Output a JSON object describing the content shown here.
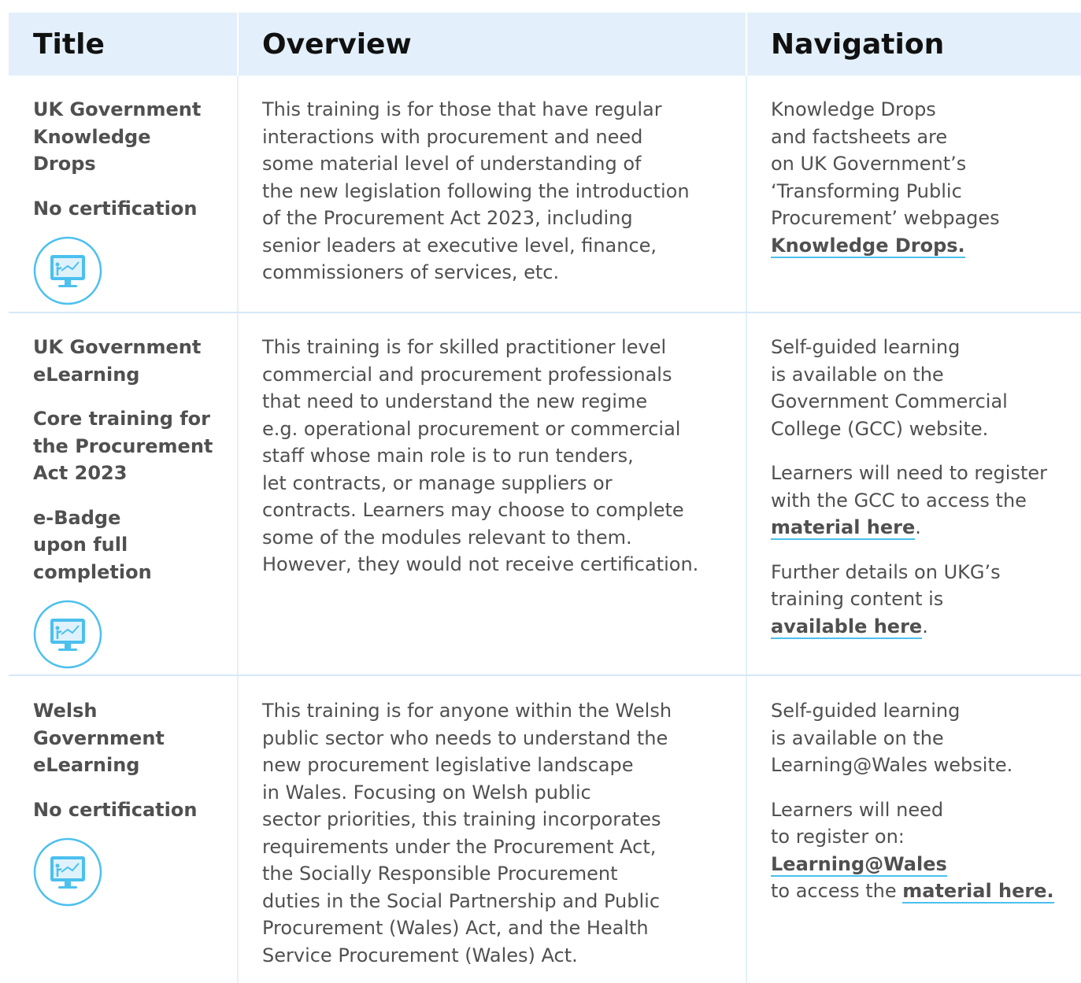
{
  "header": {
    "title": "Title",
    "overview": "Overview",
    "navigation": "Navigation"
  },
  "colors": {
    "header_bg": "#e3f0fb",
    "link_underline": "#4cc0ee",
    "icon_blue": "#4cc0ee"
  },
  "rows": [
    {
      "title_lines": [
        "UK Government",
        "Knowledge",
        "Drops"
      ],
      "cert_lines": [
        "No certification"
      ],
      "icon": "monitor-presentation-icon",
      "overview_lines": [
        "This training is for those that have regular",
        "interactions with procurement and need",
        "some material level of understanding of",
        "the new legislation following the introduction",
        "of the Procurement Act 2023, including",
        "senior leaders at executive level, finance,",
        "commissioners of services, etc."
      ],
      "nav": {
        "p1_lines": [
          "Knowledge Drops",
          "and factsheets are",
          "on UK Government’s",
          "‘Transforming Public",
          "Procurement’ webpages"
        ],
        "link": "Knowledge Drops."
      }
    },
    {
      "title_lines": [
        "UK Government",
        "eLearning"
      ],
      "sub1_lines": [
        "Core training for",
        "the Procurement",
        "Act 2023"
      ],
      "sub2_lines": [
        "e-Badge",
        "upon full",
        "completion"
      ],
      "icon": "monitor-presentation-icon",
      "overview_lines": [
        "This training is for skilled practitioner level",
        "commercial and procurement professionals",
        "that need to understand the new regime",
        "e.g. operational procurement or commercial",
        "staff whose main role is to run tenders,",
        "let contracts, or manage suppliers or",
        "contracts. Learners may choose to complete",
        "some of the modules relevant to them.",
        "However, they would not receive certification."
      ],
      "nav": {
        "p1_lines": [
          "Self-guided learning",
          "is available on the",
          "Government Commercial",
          "College (GCC) website."
        ],
        "p2_lines": [
          "Learners will need to register",
          "with the GCC to access the"
        ],
        "p2_link": "material here",
        "p2_tail": ".",
        "p3_lines": [
          "Further details on UKG’s",
          "training content is"
        ],
        "p3_link": "available here",
        "p3_tail": "."
      }
    },
    {
      "title_lines": [
        "Welsh",
        "Government",
        "eLearning"
      ],
      "cert_lines": [
        "No certification"
      ],
      "icon": "monitor-presentation-icon",
      "overview_lines": [
        "This training is for anyone within the Welsh",
        "public sector who needs to understand the",
        "new procurement legislative landscape",
        "in Wales. Focusing on Welsh public",
        "sector priorities, this training incorporates",
        "requirements under the Procurement Act,",
        "the Socially Responsible Procurement",
        "duties in the Social Partnership and Public",
        "Procurement (Wales) Act, and the Health",
        "Service Procurement (Wales) Act."
      ],
      "nav": {
        "p1_lines": [
          "Self-guided learning",
          "is available on the",
          "Learning@Wales website."
        ],
        "p2_lines": [
          "Learners will need",
          "to register on:"
        ],
        "p2_link": "Learning@Wales",
        "p2_tail_text": "to access the ",
        "p2_tail_link": "material here."
      }
    }
  ]
}
